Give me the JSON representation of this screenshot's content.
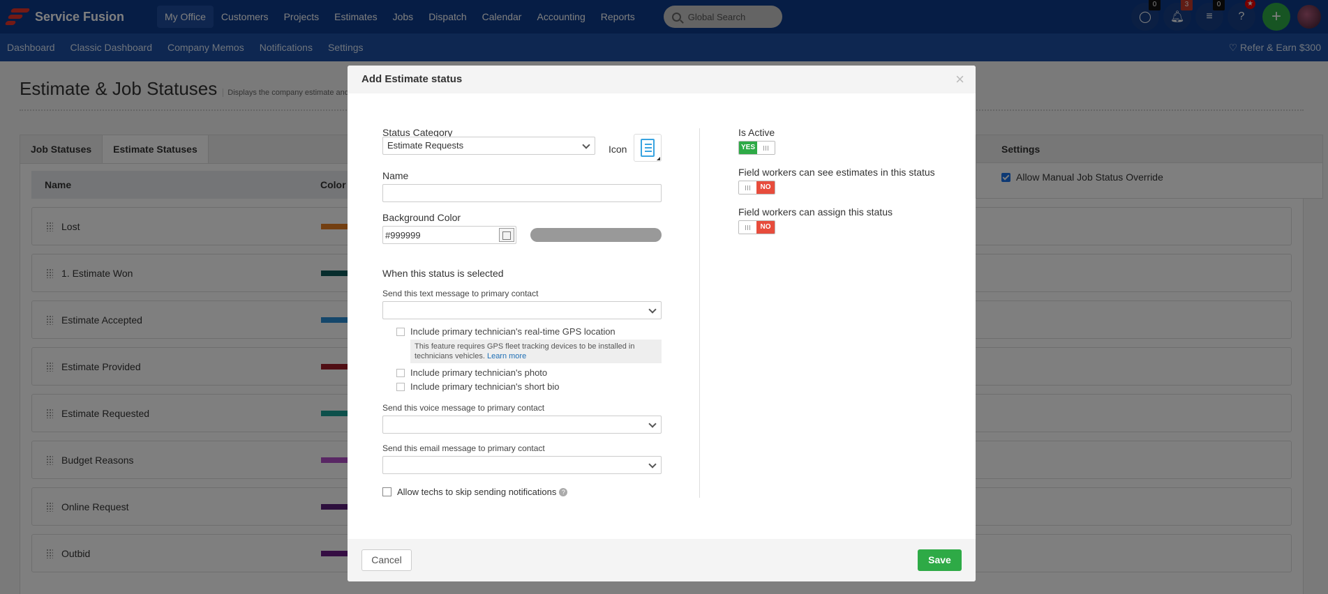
{
  "app": {
    "name": "Service Fusion"
  },
  "mainmenu": [
    "My Office",
    "Customers",
    "Projects",
    "Estimates",
    "Jobs",
    "Dispatch",
    "Calendar",
    "Accounting",
    "Reports"
  ],
  "search": {
    "placeholder": "Global Search"
  },
  "topicons": {
    "chat_count": "0",
    "notif_count": "3",
    "tasks_count": "0",
    "help": "?"
  },
  "subnav": [
    "Dashboard",
    "Classic Dashboard",
    "Company Memos",
    "Notifications",
    "Settings"
  ],
  "refer": "♡ Refer & Earn $300",
  "page": {
    "title": "Estimate & Job Statuses",
    "description": "Displays the company estimate and j",
    "tabs": [
      "Job Statuses",
      "Estimate Statuses"
    ],
    "columns": {
      "name": "Name",
      "color": "Color c"
    },
    "rows": [
      {
        "name": "Lost",
        "color": "#e67e22"
      },
      {
        "name": "1. Estimate Won",
        "color": "#0f5a5a"
      },
      {
        "name": "Estimate Accepted",
        "color": "#2b8fd6"
      },
      {
        "name": "Estimate Provided",
        "color": "#a01c28"
      },
      {
        "name": "Estimate Requested",
        "color": "#1aa097"
      },
      {
        "name": "Budget Reasons",
        "color": "#b24fc9"
      },
      {
        "name": "Online Request",
        "color": "#5b1f7a"
      },
      {
        "name": "Outbid",
        "color": "#6a1b86"
      }
    ],
    "settings": {
      "title": "Settings",
      "allow_override": "Allow Manual Job Status Override"
    }
  },
  "modal": {
    "title": "Add Estimate status",
    "close": "×",
    "status_category_label": "Status Category",
    "status_category_value": "Estimate Requests",
    "icon_label": "Icon",
    "name_label": "Name",
    "name_value": "",
    "bg_color_label": "Background Color",
    "bg_color_value": "#999999",
    "when_selected": "When this status is selected",
    "text_msg_label": "Send this text message to primary contact",
    "gps_label": "Include primary technician's real-time GPS location",
    "gps_note": "This feature requires GPS fleet tracking devices to be installed in technicians vehicles.",
    "learn_more": "Learn more",
    "photo_label": "Include primary technician's photo",
    "bio_label": "Include primary technician's short bio",
    "voice_msg_label": "Send this voice message to primary contact",
    "email_msg_label": "Send this email message to primary contact",
    "skip_label": "Allow techs to skip sending notifications",
    "is_active_label": "Is Active",
    "is_active_state": "YES",
    "fw_see_label": "Field workers can see estimates in this status",
    "fw_see_state": "NO",
    "fw_assign_label": "Field workers can assign this status",
    "fw_assign_state": "NO",
    "cancel": "Cancel",
    "save": "Save"
  }
}
